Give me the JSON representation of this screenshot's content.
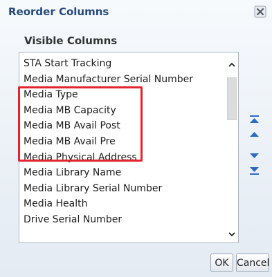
{
  "dialog": {
    "title": "Reorder Columns",
    "close_icon": "close-x-icon"
  },
  "visible_columns": {
    "label": "Visible Columns",
    "items": [
      "STA Start Tracking",
      "Media Manufacturer Serial Number",
      "Media Type",
      "Media MB Capacity",
      "Media MB Avail Post",
      "Media MB Avail Pre",
      "Media Physical Address",
      "Media Library Name",
      "Media Library Serial Number",
      "Media Health",
      "Drive Serial Number"
    ],
    "highlighted_items": [
      "Media Type",
      "Media MB Capacity",
      "Media MB Avail Post",
      "Media MB Avail Pre"
    ],
    "highlight_color": "#e0262c"
  },
  "move_controls": {
    "icons": [
      "move-to-top-icon",
      "move-up-icon",
      "move-down-icon",
      "move-to-bottom-icon"
    ],
    "color": "#2a6bc4"
  },
  "buttons": {
    "ok_label": "OK",
    "cancel_label": "Cancel"
  },
  "colors": {
    "title": "#264a79",
    "dialog_bg": "#eaf0f6"
  }
}
